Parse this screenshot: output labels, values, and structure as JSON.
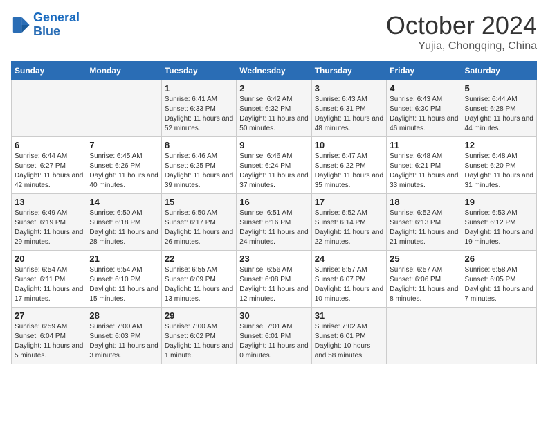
{
  "header": {
    "logo_line1": "General",
    "logo_line2": "Blue",
    "month_title": "October 2024",
    "subtitle": "Yujia, Chongqing, China"
  },
  "days_of_week": [
    "Sunday",
    "Monday",
    "Tuesday",
    "Wednesday",
    "Thursday",
    "Friday",
    "Saturday"
  ],
  "weeks": [
    [
      {
        "day": "",
        "info": ""
      },
      {
        "day": "",
        "info": ""
      },
      {
        "day": "1",
        "info": "Sunrise: 6:41 AM\nSunset: 6:33 PM\nDaylight: 11 hours and 52 minutes."
      },
      {
        "day": "2",
        "info": "Sunrise: 6:42 AM\nSunset: 6:32 PM\nDaylight: 11 hours and 50 minutes."
      },
      {
        "day": "3",
        "info": "Sunrise: 6:43 AM\nSunset: 6:31 PM\nDaylight: 11 hours and 48 minutes."
      },
      {
        "day": "4",
        "info": "Sunrise: 6:43 AM\nSunset: 6:30 PM\nDaylight: 11 hours and 46 minutes."
      },
      {
        "day": "5",
        "info": "Sunrise: 6:44 AM\nSunset: 6:28 PM\nDaylight: 11 hours and 44 minutes."
      }
    ],
    [
      {
        "day": "6",
        "info": "Sunrise: 6:44 AM\nSunset: 6:27 PM\nDaylight: 11 hours and 42 minutes."
      },
      {
        "day": "7",
        "info": "Sunrise: 6:45 AM\nSunset: 6:26 PM\nDaylight: 11 hours and 40 minutes."
      },
      {
        "day": "8",
        "info": "Sunrise: 6:46 AM\nSunset: 6:25 PM\nDaylight: 11 hours and 39 minutes."
      },
      {
        "day": "9",
        "info": "Sunrise: 6:46 AM\nSunset: 6:24 PM\nDaylight: 11 hours and 37 minutes."
      },
      {
        "day": "10",
        "info": "Sunrise: 6:47 AM\nSunset: 6:22 PM\nDaylight: 11 hours and 35 minutes."
      },
      {
        "day": "11",
        "info": "Sunrise: 6:48 AM\nSunset: 6:21 PM\nDaylight: 11 hours and 33 minutes."
      },
      {
        "day": "12",
        "info": "Sunrise: 6:48 AM\nSunset: 6:20 PM\nDaylight: 11 hours and 31 minutes."
      }
    ],
    [
      {
        "day": "13",
        "info": "Sunrise: 6:49 AM\nSunset: 6:19 PM\nDaylight: 11 hours and 29 minutes."
      },
      {
        "day": "14",
        "info": "Sunrise: 6:50 AM\nSunset: 6:18 PM\nDaylight: 11 hours and 28 minutes."
      },
      {
        "day": "15",
        "info": "Sunrise: 6:50 AM\nSunset: 6:17 PM\nDaylight: 11 hours and 26 minutes."
      },
      {
        "day": "16",
        "info": "Sunrise: 6:51 AM\nSunset: 6:16 PM\nDaylight: 11 hours and 24 minutes."
      },
      {
        "day": "17",
        "info": "Sunrise: 6:52 AM\nSunset: 6:14 PM\nDaylight: 11 hours and 22 minutes."
      },
      {
        "day": "18",
        "info": "Sunrise: 6:52 AM\nSunset: 6:13 PM\nDaylight: 11 hours and 21 minutes."
      },
      {
        "day": "19",
        "info": "Sunrise: 6:53 AM\nSunset: 6:12 PM\nDaylight: 11 hours and 19 minutes."
      }
    ],
    [
      {
        "day": "20",
        "info": "Sunrise: 6:54 AM\nSunset: 6:11 PM\nDaylight: 11 hours and 17 minutes."
      },
      {
        "day": "21",
        "info": "Sunrise: 6:54 AM\nSunset: 6:10 PM\nDaylight: 11 hours and 15 minutes."
      },
      {
        "day": "22",
        "info": "Sunrise: 6:55 AM\nSunset: 6:09 PM\nDaylight: 11 hours and 13 minutes."
      },
      {
        "day": "23",
        "info": "Sunrise: 6:56 AM\nSunset: 6:08 PM\nDaylight: 11 hours and 12 minutes."
      },
      {
        "day": "24",
        "info": "Sunrise: 6:57 AM\nSunset: 6:07 PM\nDaylight: 11 hours and 10 minutes."
      },
      {
        "day": "25",
        "info": "Sunrise: 6:57 AM\nSunset: 6:06 PM\nDaylight: 11 hours and 8 minutes."
      },
      {
        "day": "26",
        "info": "Sunrise: 6:58 AM\nSunset: 6:05 PM\nDaylight: 11 hours and 7 minutes."
      }
    ],
    [
      {
        "day": "27",
        "info": "Sunrise: 6:59 AM\nSunset: 6:04 PM\nDaylight: 11 hours and 5 minutes."
      },
      {
        "day": "28",
        "info": "Sunrise: 7:00 AM\nSunset: 6:03 PM\nDaylight: 11 hours and 3 minutes."
      },
      {
        "day": "29",
        "info": "Sunrise: 7:00 AM\nSunset: 6:02 PM\nDaylight: 11 hours and 1 minute."
      },
      {
        "day": "30",
        "info": "Sunrise: 7:01 AM\nSunset: 6:01 PM\nDaylight: 11 hours and 0 minutes."
      },
      {
        "day": "31",
        "info": "Sunrise: 7:02 AM\nSunset: 6:01 PM\nDaylight: 10 hours and 58 minutes."
      },
      {
        "day": "",
        "info": ""
      },
      {
        "day": "",
        "info": ""
      }
    ]
  ]
}
